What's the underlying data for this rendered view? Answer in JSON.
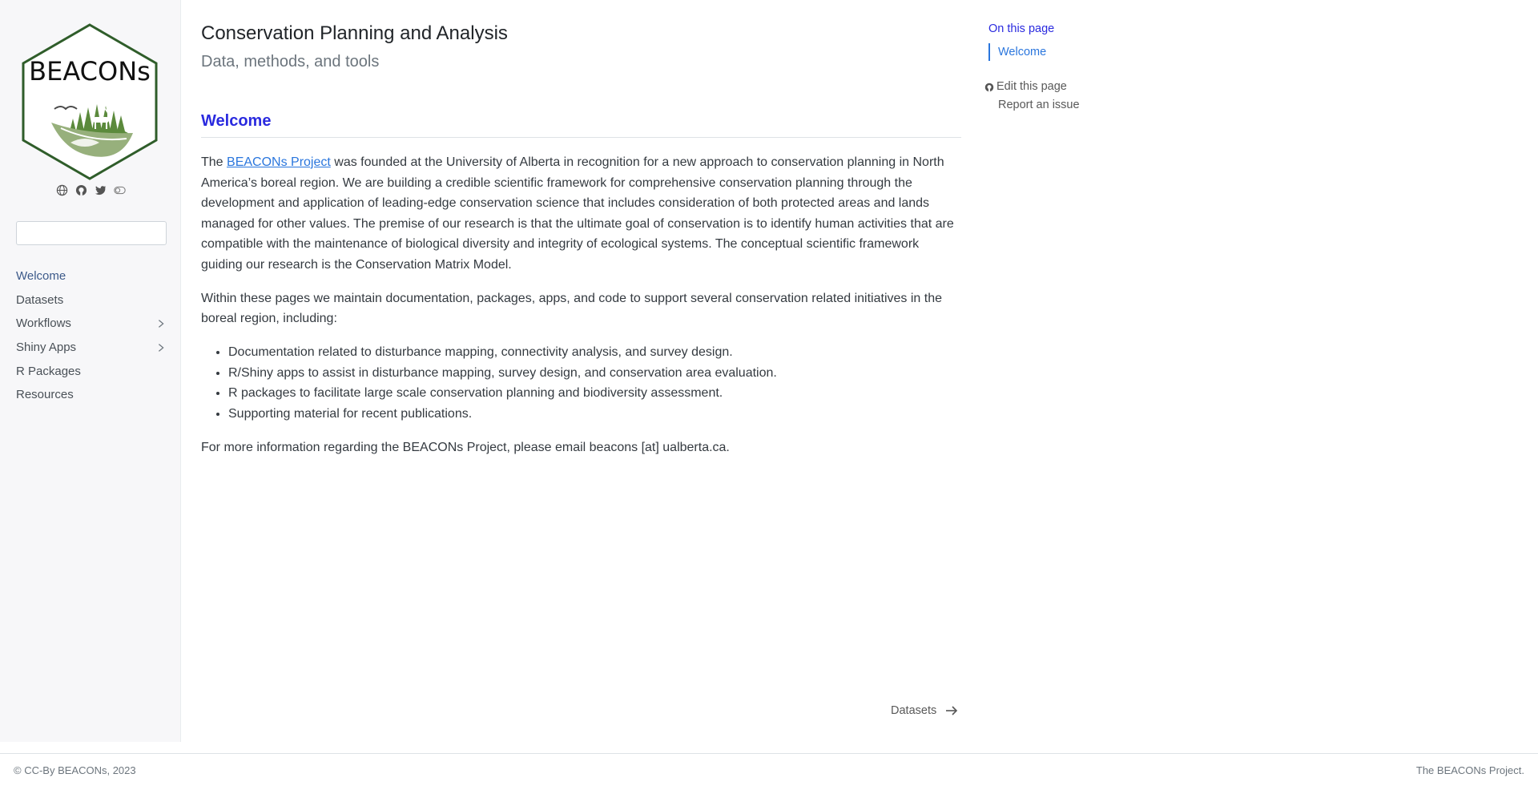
{
  "brand": {
    "logo_text": "BEACONs",
    "colors": {
      "hex_border": "#2f5d2a",
      "green_fill": "#5b8a3c",
      "leaf_fill": "#97b07c"
    }
  },
  "social_icons": [
    "globe-icon",
    "github-icon",
    "twitter-icon",
    "toggle-icon"
  ],
  "search": {
    "placeholder": "",
    "value": ""
  },
  "sidebar": {
    "items": [
      {
        "label": "Welcome",
        "active": true,
        "expandable": false
      },
      {
        "label": "Datasets",
        "active": false,
        "expandable": false
      },
      {
        "label": "Workflows",
        "active": false,
        "expandable": true
      },
      {
        "label": "Shiny Apps",
        "active": false,
        "expandable": true
      },
      {
        "label": "R Packages",
        "active": false,
        "expandable": false
      },
      {
        "label": "Resources",
        "active": false,
        "expandable": false
      }
    ]
  },
  "header": {
    "title": "Conservation Planning and Analysis",
    "subtitle": "Data, methods, and tools"
  },
  "main": {
    "section_heading": "Welcome",
    "p1_before": "The ",
    "p1_link": "BEACONs Project",
    "p1_after": " was founded at the University of Alberta in recognition for a new approach to conservation planning in North America’s boreal region. We are building a credible scientific framework for comprehensive conservation planning through the development and application of leading-edge conservation science that includes consideration of both protected areas and lands managed for other values. The premise of our research is that the ultimate goal of conservation is to identify human activities that are compatible with the maintenance of biological diversity and integrity of ecological systems. The conceptual scientific framework guiding our research is the Conservation Matrix Model.",
    "p2": "Within these pages we maintain documentation, packages, apps, and code to support several conservation related initiatives in the boreal region, including:",
    "bullets": [
      "Documentation related to disturbance mapping, connectivity analysis, and survey design.",
      "R/Shiny apps to assist in disturbance mapping, survey design, and conservation area evaluation.",
      "R packages to facilitate large scale conservation planning and biodiversity assessment.",
      "Supporting material for recent publications."
    ],
    "p3": "For more information regarding the BEACONs Project, please email beacons [at] ualberta.ca.",
    "next_label": "Datasets"
  },
  "toc": {
    "title": "On this page",
    "items": [
      "Welcome"
    ],
    "edit_label": "Edit this page",
    "report_label": "Report an issue"
  },
  "footer": {
    "left": "© CC-By BEACONs, 2023",
    "right": "The BEACONs Project."
  }
}
